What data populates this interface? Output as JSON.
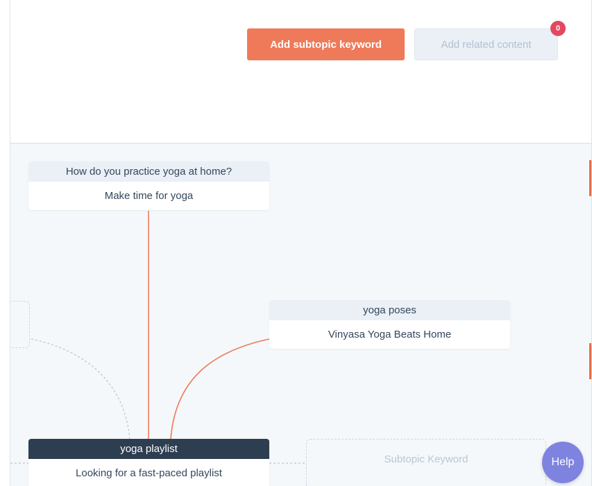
{
  "toolbar": {
    "add_subtopic_label": "Add subtopic keyword",
    "add_related_label": "Add related content",
    "related_count": "0"
  },
  "cards": {
    "subtopic_home": {
      "keyword": "How do you practice yoga at home?",
      "content": "Make time for yoga"
    },
    "subtopic_poses": {
      "keyword": "yoga poses",
      "content": "Vinyasa Yoga Beats Home"
    },
    "pillar": {
      "keyword": "yoga playlist",
      "content": "Looking for a fast-paced playlist"
    }
  },
  "placeholder": {
    "label": "Subtopic Keyword"
  },
  "help": {
    "label": "Help"
  },
  "colors": {
    "primary": "#ee7a59",
    "link_line": "#ee7a59",
    "pillar_header": "#2d3e50",
    "badge": "#e4475f",
    "help": "#7f83e0"
  }
}
